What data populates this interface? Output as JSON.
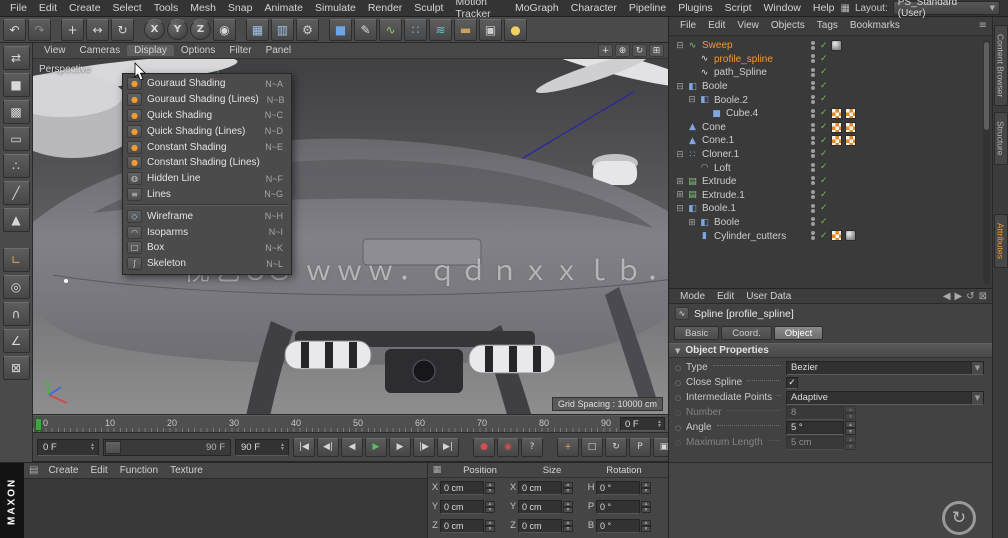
{
  "menubar": {
    "items": [
      "File",
      "Edit",
      "Create",
      "Select",
      "Tools",
      "Mesh",
      "Snap",
      "Animate",
      "Simulate",
      "Render",
      "Sculpt",
      "Motion Tracker",
      "MoGraph",
      "Character",
      "Pipeline",
      "Plugins",
      "Script",
      "Window",
      "Help"
    ],
    "layout_label": "Layout:",
    "layout_value": "PS_Standard (User)"
  },
  "toolbar": {
    "icons": [
      {
        "name": "undo-icon",
        "glyph": "↶"
      },
      {
        "name": "redo-icon",
        "glyph": "↷",
        "dim": true
      },
      {
        "name": "sep"
      },
      {
        "name": "move-tool-icon",
        "glyph": "+"
      },
      {
        "name": "scale-tool-icon",
        "glyph": "↔"
      },
      {
        "name": "rotate-tool-icon",
        "glyph": "↻"
      },
      {
        "name": "sep"
      },
      {
        "name": "x-axis-button",
        "glyph": "X",
        "round": true
      },
      {
        "name": "y-axis-button",
        "glyph": "Y",
        "round": true
      },
      {
        "name": "z-axis-button",
        "glyph": "Z",
        "round": true
      },
      {
        "name": "coordinate-system-icon",
        "glyph": "◉"
      },
      {
        "name": "sep"
      },
      {
        "name": "render-view-icon",
        "glyph": "▦",
        "tint": "#9fc3e8"
      },
      {
        "name": "render-region-icon",
        "glyph": "▥",
        "tint": "#9fc3e8"
      },
      {
        "name": "render-settings-icon",
        "glyph": "⚙",
        "tint": "#d0d0d0"
      },
      {
        "name": "sep"
      },
      {
        "name": "primitive-cube-icon",
        "glyph": "■",
        "tint": "#6aa6e8"
      },
      {
        "name": "spline-pen-icon",
        "glyph": "✎",
        "tint": "#dddddd"
      },
      {
        "name": "generators-icon",
        "glyph": "∿",
        "tint": "#8cc85a"
      },
      {
        "name": "mograph-icon",
        "glyph": "∷",
        "tint": "#6ab0e8"
      },
      {
        "name": "simulate-icon",
        "glyph": "≋",
        "tint": "#5ac8c8"
      },
      {
        "name": "floor-icon",
        "glyph": "▬",
        "tint": "#c8a05a"
      },
      {
        "name": "camera-icon",
        "glyph": "▣",
        "tint": "#cccccc"
      },
      {
        "name": "light-icon",
        "glyph": "●",
        "tint": "#f0d060"
      }
    ]
  },
  "left_toolbar": {
    "icons": [
      {
        "name": "make-editable-icon",
        "glyph": "⇄"
      },
      {
        "name": "model-mode-icon",
        "glyph": "■"
      },
      {
        "name": "texture-mode-icon",
        "glyph": "▩"
      },
      {
        "name": "workplane-mode-icon",
        "glyph": "▭"
      },
      {
        "name": "points-mode-icon",
        "glyph": "∴"
      },
      {
        "name": "edges-mode-icon",
        "glyph": "╱"
      },
      {
        "name": "polygons-mode-icon",
        "glyph": "▲"
      },
      {
        "name": "sep"
      },
      {
        "name": "axis-mode-icon",
        "glyph": "∟",
        "tint": "#e0a050"
      },
      {
        "name": "solo-mode-icon",
        "glyph": "◎"
      },
      {
        "name": "snap-mode-icon",
        "glyph": "∩"
      },
      {
        "name": "quantize-icon",
        "glyph": "∠"
      },
      {
        "name": "lock-workplane-icon",
        "glyph": "⊠"
      }
    ]
  },
  "viewport": {
    "menus": [
      "View",
      "Cameras",
      "Display",
      "Options",
      "Filter",
      "Panel"
    ],
    "active_menu": "Display",
    "nav_icons": [
      {
        "name": "pan-view-icon",
        "glyph": "+"
      },
      {
        "name": "zoom-view-icon",
        "glyph": "⊕"
      },
      {
        "name": "rotate-view-icon",
        "glyph": "↻"
      },
      {
        "name": "toggle-view-icon",
        "glyph": "⊞"
      }
    ],
    "camera_label": "Perspective",
    "grid_spacing": "Grid Spacing : 10000 cm",
    "watermark": "视艺CG ｗｗｗ．ｑｄｎｘｘｌｂ．ｃｏｍ"
  },
  "display_menu": {
    "items": [
      {
        "label": "Gouraud Shading",
        "shortcut": "N~A",
        "icon_glyph": "●",
        "icon_color": "#f09a30"
      },
      {
        "label": "Gouraud Shading (Lines)",
        "shortcut": "N~B",
        "icon_glyph": "●",
        "icon_color": "#f09a30"
      },
      {
        "label": "Quick Shading",
        "shortcut": "N~C",
        "icon_glyph": "●",
        "icon_color": "#f09a30"
      },
      {
        "label": "Quick Shading (Lines)",
        "shortcut": "N~D",
        "icon_glyph": "●",
        "icon_color": "#f09a30"
      },
      {
        "label": "Constant Shading",
        "shortcut": "N~E",
        "icon_glyph": "●",
        "icon_color": "#f09a30"
      },
      {
        "label": "Constant Shading (Lines)",
        "shortcut": "",
        "icon_glyph": "●",
        "icon_color": "#f09a30"
      },
      {
        "label": "Hidden Line",
        "shortcut": "N~F",
        "icon_glyph": "◍",
        "icon_color": "#c8c8c8"
      },
      {
        "label": "Lines",
        "shortcut": "N~G",
        "icon_glyph": "≡",
        "icon_color": "#c8c8c8"
      },
      {
        "separator": true
      },
      {
        "label": "Wireframe",
        "shortcut": "N~H",
        "icon_glyph": "◇",
        "icon_color": "#9ec7ff"
      },
      {
        "label": "Isoparms",
        "shortcut": "N~I",
        "icon_glyph": "◠",
        "icon_color": "#c8c8c8"
      },
      {
        "label": "Box",
        "shortcut": "N~K",
        "icon_glyph": "□",
        "icon_color": "#c8c8c8"
      },
      {
        "label": "Skeleton",
        "shortcut": "N~L",
        "icon_glyph": "∫",
        "icon_color": "#c8c8c8"
      }
    ]
  },
  "timeline": {
    "ticks": [
      "0",
      "10",
      "20",
      "30",
      "40",
      "50",
      "60",
      "70",
      "80",
      "90"
    ],
    "frame_field": "0 F"
  },
  "transport": {
    "current": "0 F",
    "range_end": "90 F",
    "end_field": "90 F",
    "buttons": [
      {
        "name": "goto-start-button",
        "glyph": "|◀"
      },
      {
        "name": "prev-key-button",
        "glyph": "◀|"
      },
      {
        "name": "prev-frame-button",
        "glyph": "◀"
      },
      {
        "name": "play-button",
        "glyph": "▶",
        "color": "#58c058"
      },
      {
        "name": "next-frame-button",
        "glyph": "▶"
      },
      {
        "name": "next-key-button",
        "glyph": "|▶"
      },
      {
        "name": "goto-end-button",
        "glyph": "▶|"
      },
      {
        "name": "gap"
      },
      {
        "name": "record-keyframe-button",
        "glyph": "●",
        "color": "#d05050"
      },
      {
        "name": "autokey-button",
        "glyph": "◉",
        "color": "#d05050"
      },
      {
        "name": "keyframe-selection-button",
        "glyph": "?"
      },
      {
        "name": "gap"
      },
      {
        "name": "record-position-toggle",
        "glyph": "+",
        "color": "#e0a050"
      },
      {
        "name": "record-scale-toggle",
        "glyph": "□"
      },
      {
        "name": "record-rotation-toggle",
        "glyph": "↻"
      },
      {
        "name": "record-parameter-toggle",
        "glyph": "P"
      },
      {
        "name": "record-pla-toggle",
        "glyph": "▣"
      }
    ]
  },
  "object_manager": {
    "menus": [
      "File",
      "Edit",
      "View",
      "Objects",
      "Tags",
      "Bookmarks"
    ],
    "window_icons": [
      {
        "name": "panel-menu-icon",
        "glyph": "≡"
      }
    ],
    "icon_glyphs": {
      "sweep": "∿",
      "spline": "∿",
      "boole": "◧",
      "cube": "■",
      "cone": "▲",
      "cloner": "∷",
      "loft": "◠",
      "extrude": "▤",
      "cylinder": "▮"
    },
    "icon_colors": {
      "sweep": "#7ec87e",
      "spline": "#e0e0e0",
      "boole": "#7ea6e0",
      "cube": "#7ea6e0",
      "cone": "#7ea6e0",
      "cloner": "#7ea6e0",
      "loft": "#7ec87e",
      "extrude": "#7ec87e",
      "cylinder": "#7ea6e0"
    },
    "objects": [
      {
        "name": "Sweep",
        "depth": 0,
        "icon": "sweep",
        "expander": "minus",
        "selected": true,
        "tags": [
          "phong"
        ]
      },
      {
        "name": "profile_spline",
        "depth": 1,
        "icon": "spline",
        "selected": true,
        "tags": []
      },
      {
        "name": "path_Spline",
        "depth": 1,
        "icon": "spline",
        "tags": []
      },
      {
        "name": "Boole",
        "depth": 0,
        "icon": "boole",
        "expander": "minus",
        "tags": []
      },
      {
        "name": "Boole.2",
        "depth": 1,
        "icon": "boole",
        "expander": "minus",
        "tags": []
      },
      {
        "name": "Cube.4",
        "depth": 2,
        "icon": "cube",
        "tags": [
          "checker",
          "checker"
        ]
      },
      {
        "name": "Cone",
        "depth": 0,
        "icon": "cone",
        "tags": [
          "checker",
          "checker"
        ]
      },
      {
        "name": "Cone.1",
        "depth": 0,
        "icon": "cone",
        "tags": [
          "checker",
          "checker"
        ]
      },
      {
        "name": "Cloner.1",
        "depth": 0,
        "icon": "cloner",
        "expander": "minus",
        "tags": []
      },
      {
        "name": "Loft",
        "depth": 1,
        "icon": "loft",
        "tags": []
      },
      {
        "name": "Extrude",
        "depth": 0,
        "icon": "extrude",
        "expander": "plus",
        "tags": []
      },
      {
        "name": "Extrude.1",
        "depth": 0,
        "icon": "extrude",
        "expander": "plus",
        "tags": []
      },
      {
        "name": "Boole.1",
        "depth": 0,
        "icon": "boole",
        "expander": "minus",
        "tags": []
      },
      {
        "name": "Boole",
        "depth": 1,
        "icon": "boole",
        "expander": "plus",
        "tags": []
      },
      {
        "name": "Cylinder_cutters",
        "depth": 1,
        "icon": "cylinder",
        "tags": [
          "checker",
          "phong"
        ]
      }
    ]
  },
  "attribute_manager": {
    "menus": [
      "Mode",
      "Edit",
      "User Data"
    ],
    "window_icons": [
      {
        "name": "back-arrow-icon",
        "glyph": "◀"
      },
      {
        "name": "forward-arrow-icon",
        "glyph": "▶"
      },
      {
        "name": "history-icon",
        "glyph": "↺"
      },
      {
        "name": "lock-icon",
        "glyph": "⊠"
      }
    ],
    "title": "Spline [profile_spline]",
    "tabs": [
      "Basic",
      "Coord.",
      "Object"
    ],
    "active_tab": "Object",
    "section": "Object Properties",
    "rows": [
      {
        "label": "Type",
        "control": "dropdown",
        "value": "Bezier"
      },
      {
        "label": "Close Spline",
        "control": "checkbox",
        "checked": true
      },
      {
        "label": "Intermediate Points",
        "control": "dropdown",
        "value": "Adaptive"
      },
      {
        "label": "Number",
        "control": "spinner",
        "value": "8",
        "disabled": true
      },
      {
        "label": "Angle",
        "control": "spinner",
        "value": "5 °"
      },
      {
        "label": "Maximum Length",
        "control": "spinner",
        "value": "5 cm",
        "disabled": true
      }
    ]
  },
  "coordinates": {
    "headers": [
      "Position",
      "Size",
      "Rotation"
    ],
    "rows": [
      {
        "pos_label": "X",
        "pos": "0 cm",
        "size_label": "X",
        "size": "0 cm",
        "rot_label": "H",
        "rot": "0 °"
      },
      {
        "pos_label": "Y",
        "pos": "0 cm",
        "size_label": "Y",
        "size": "0 cm",
        "rot_label": "P",
        "rot": "0 °"
      },
      {
        "pos_label": "Z",
        "pos": "0 cm",
        "size_label": "Z",
        "size": "0 cm",
        "rot_label": "B",
        "rot": "0 °"
      }
    ]
  },
  "materials": {
    "menus": [
      "Create",
      "Edit",
      "Function",
      "Texture"
    ]
  },
  "branding": {
    "left_vertical": "MAXON",
    "right_tabs": [
      {
        "label": "Content Browser"
      },
      {
        "label": "Structure"
      },
      {
        "label": "Attributes",
        "active": true
      }
    ]
  }
}
